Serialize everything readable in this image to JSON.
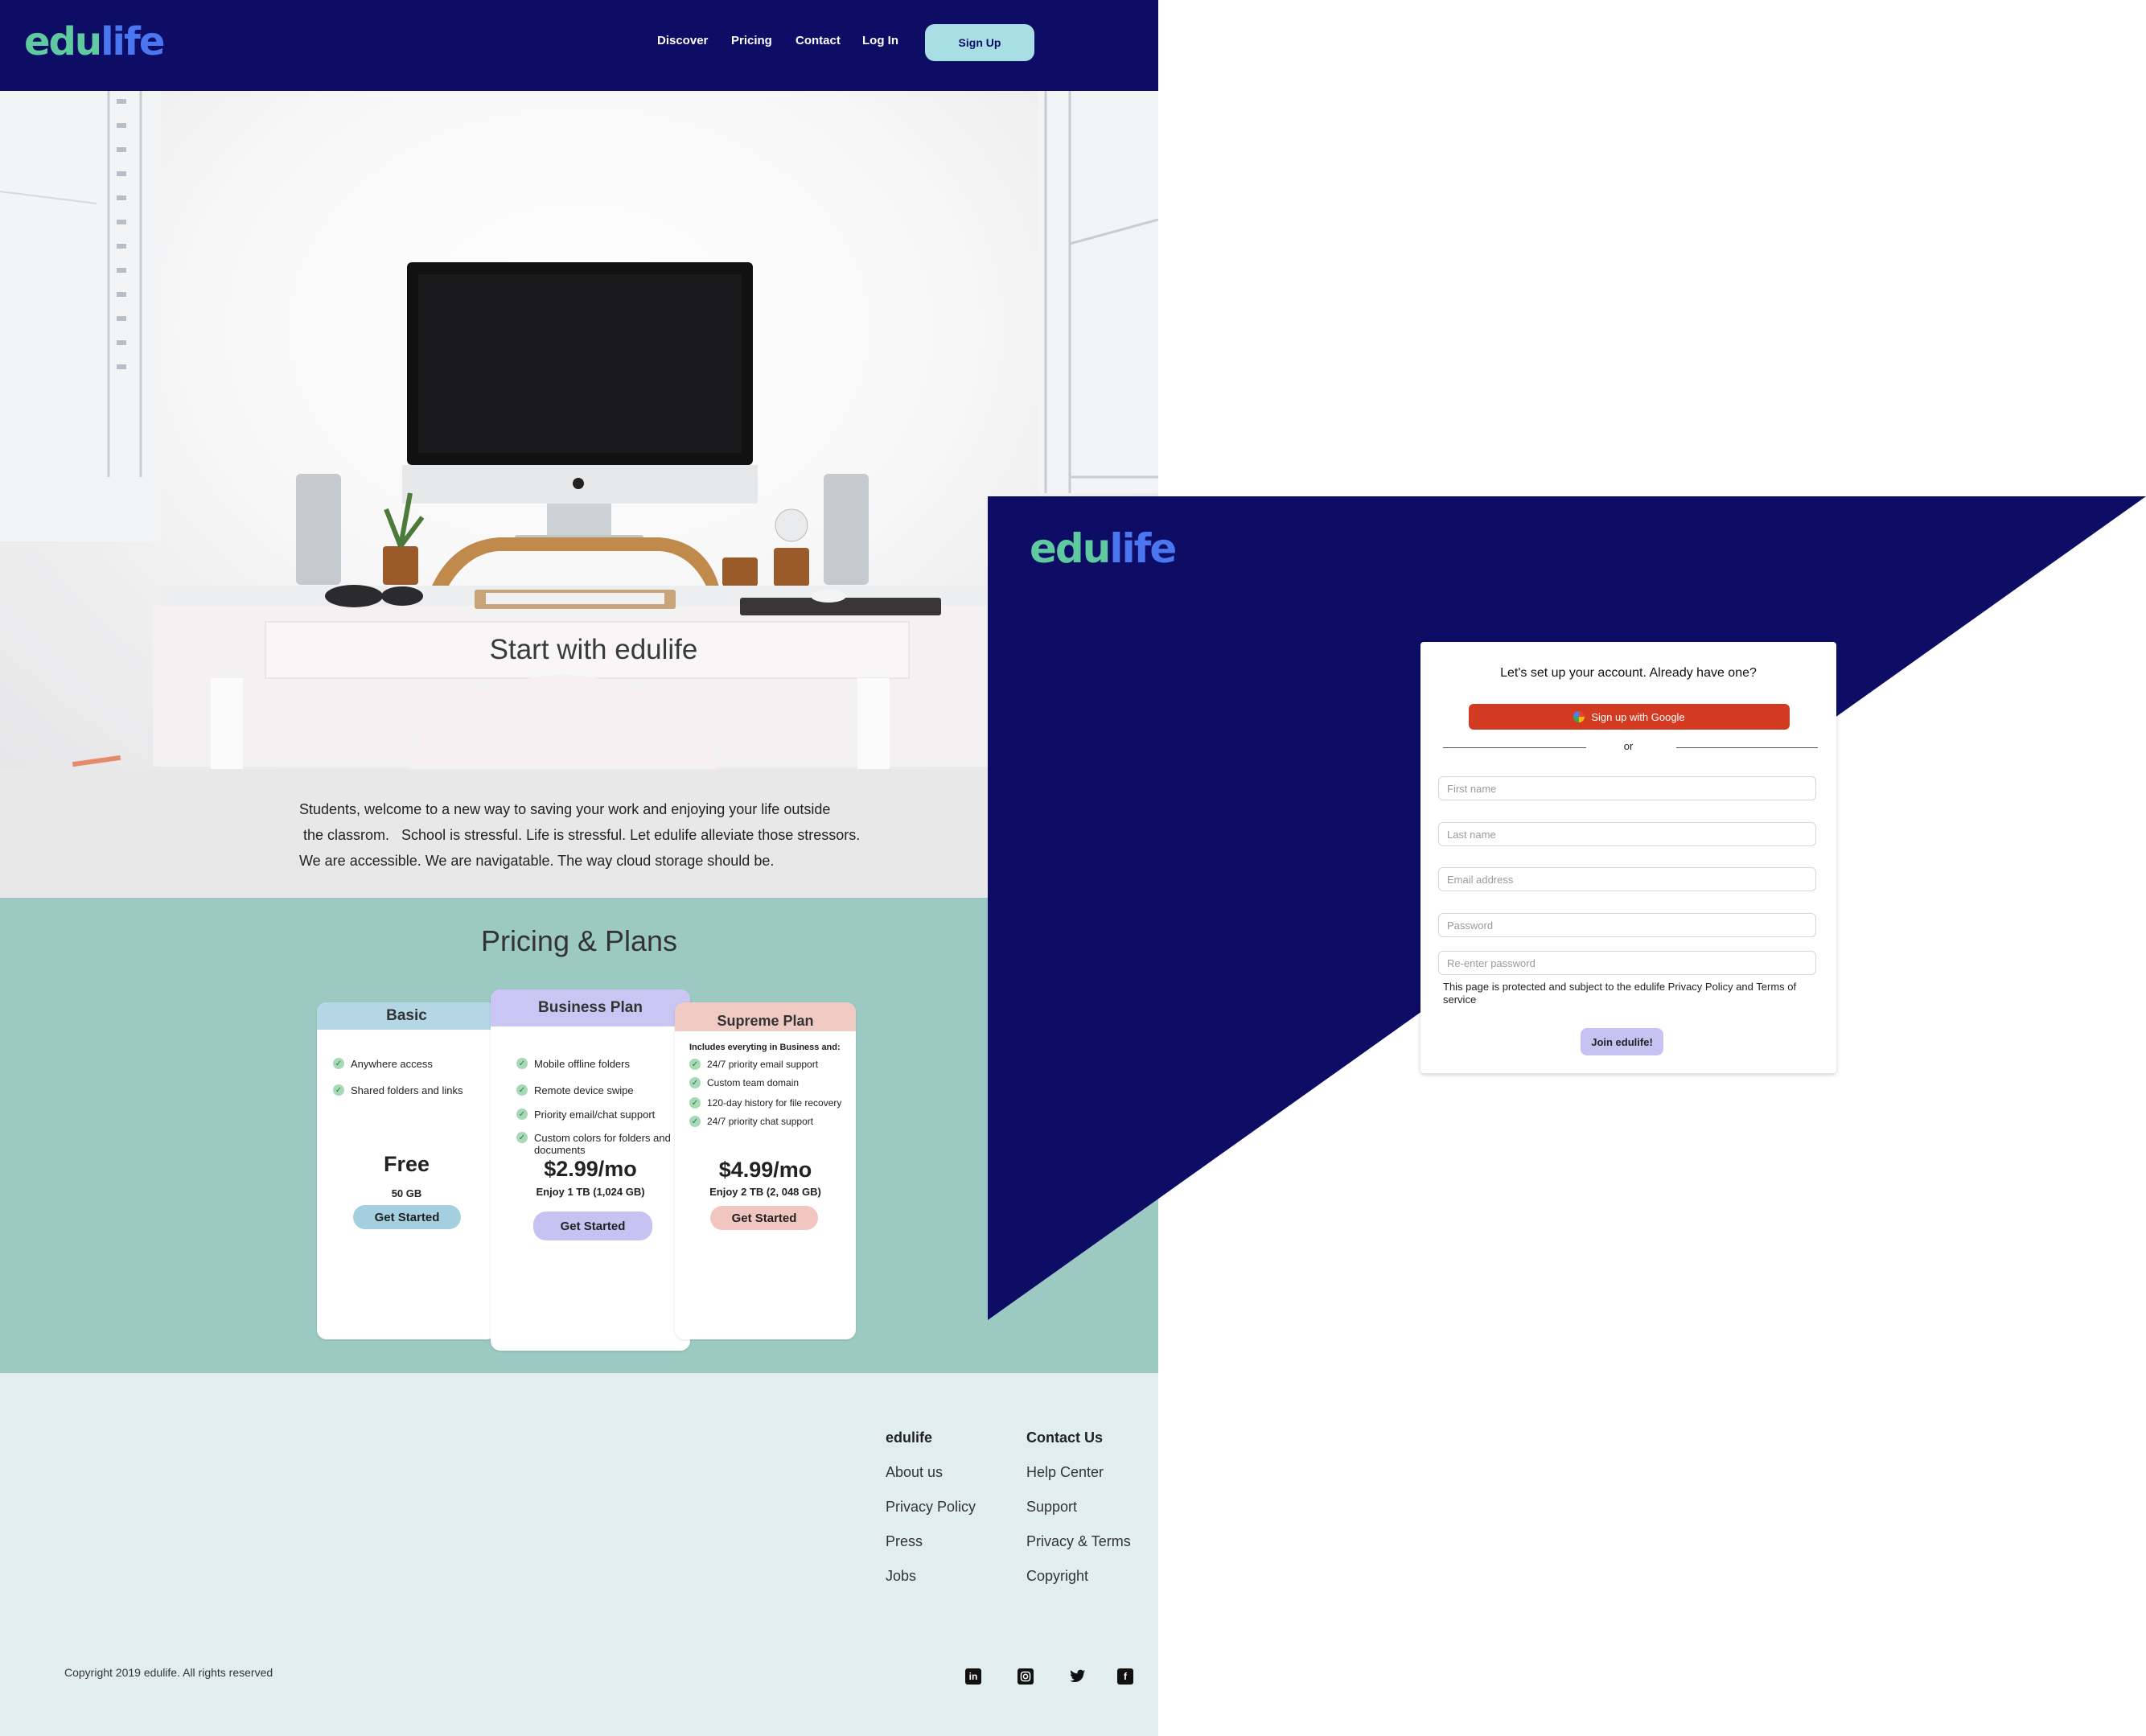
{
  "brand": {
    "logo_part1": "edu",
    "logo_part2": "life"
  },
  "nav": {
    "links": [
      "Discover",
      "Pricing",
      "Contact",
      "Log In"
    ],
    "signup_label": "Sign Up"
  },
  "hero": {
    "title": "Start with edulife"
  },
  "intro": {
    "lines": [
      "Students, welcome to a new way to saving your work and enjoying your life outside",
      " the classrom.   School is stressful. Life is stressful. Let edulife alleviate those stressors.",
      "We are accessible. We are navigatable. The way cloud storage should be."
    ]
  },
  "pricing": {
    "title": "Pricing & Plans",
    "plans": [
      {
        "name": "Basic",
        "header_color": "#b5d7e5",
        "features": [
          "Anywhere access",
          "Shared folders and links"
        ],
        "price": "Free",
        "storage": "50 GB",
        "cta": "Get Started",
        "cta_color": "#a4cfe0"
      },
      {
        "name": "Business Plan",
        "header_color": "#c9c6f4",
        "features": [
          "Mobile offline folders",
          "Remote device swipe",
          "Priority email/chat support",
          "Custom colors for folders and documents"
        ],
        "price": "$2.99/mo",
        "storage": "Enjoy 1 TB (1,024 GB)",
        "cta": "Get Started",
        "cta_color": "#c6c3f2"
      },
      {
        "name": "Supreme Plan",
        "header_color": "#f0cbc4",
        "intro": "Includes everyting in Business and:",
        "features": [
          "24/7 priority email support",
          "Custom team domain",
          "120-day history for file recovery",
          "24/7 priority chat support"
        ],
        "price": "$4.99/mo",
        "storage": "Enjoy 2 TB (2, 048 GB)",
        "cta": "Get Started",
        "cta_color": "#f2c6c0"
      }
    ]
  },
  "footer": {
    "col1": {
      "heading": "edulife",
      "links": [
        "About us",
        "Privacy Policy",
        "Press",
        "Jobs"
      ]
    },
    "col2": {
      "heading": "Contact Us",
      "links": [
        "Help Center",
        "Support",
        "Privacy & Terms",
        "Copyright"
      ]
    },
    "copyright": "Copyright 2019 edulife. All rights reserved",
    "social": [
      "linkedin-icon",
      "instagram-icon",
      "twitter-icon",
      "facebook-icon"
    ]
  },
  "signup": {
    "heading": "Let's set up your account. Already have one?",
    "google_label": "Sign up with Google",
    "or": "or",
    "fields": {
      "first_name": "First name",
      "last_name": "Last name",
      "email": "Email address",
      "password": "Password",
      "reenter": "Re-enter password"
    },
    "notice": "This page is protected and subject to the edulife Privacy Policy and Terms of service",
    "join_label": "Join edulife!"
  },
  "colors": {
    "navy": "#0d0d66",
    "teal": "#9ccac3",
    "footer_bg": "#e2eeee",
    "google_red": "#d23b22",
    "logo_green": "#5fcaa0",
    "logo_blue": "#4a76f0"
  }
}
